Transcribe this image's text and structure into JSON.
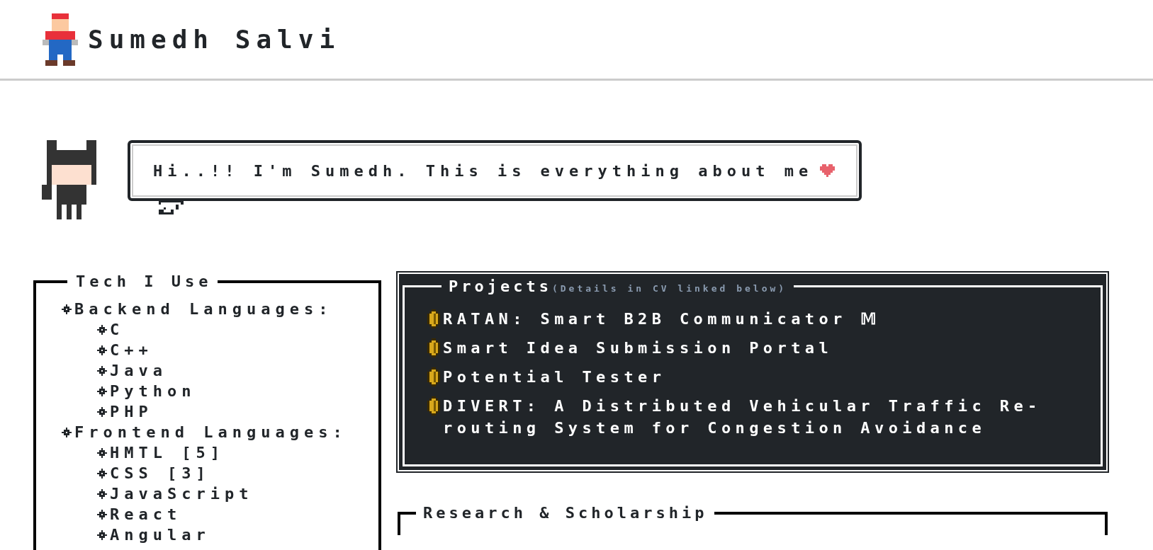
{
  "header": {
    "title": "Sumedh Salvi"
  },
  "greeting": {
    "text": "Hi..!! I'm Sumedh. This is everything about me"
  },
  "tech": {
    "title": "Tech I Use",
    "items": [
      {
        "label": "Backend Languages:",
        "children": [
          {
            "label": "C"
          },
          {
            "label": "C++"
          },
          {
            "label": "Java"
          },
          {
            "label": "Python"
          },
          {
            "label": "PHP"
          }
        ]
      },
      {
        "label": "Frontend Languages:",
        "children": [
          {
            "label": "HMTL [5]"
          },
          {
            "label": "CSS [3]"
          },
          {
            "label": "JavaScript"
          },
          {
            "label": "React"
          },
          {
            "label": "Angular"
          }
        ]
      }
    ]
  },
  "projects": {
    "title": "Projects",
    "note": "(Details in CV linked below)",
    "items": [
      {
        "label": "RATAN: Smart B2B Communicator 𝕄"
      },
      {
        "label": " Smart Idea Submission Portal"
      },
      {
        "label": " Potential Tester"
      },
      {
        "label": "DIVERT: A Distributed Vehicular Traffic Re-routing System for Congestion Avoidance"
      }
    ]
  },
  "research": {
    "title": "Research & Scholarship"
  }
}
